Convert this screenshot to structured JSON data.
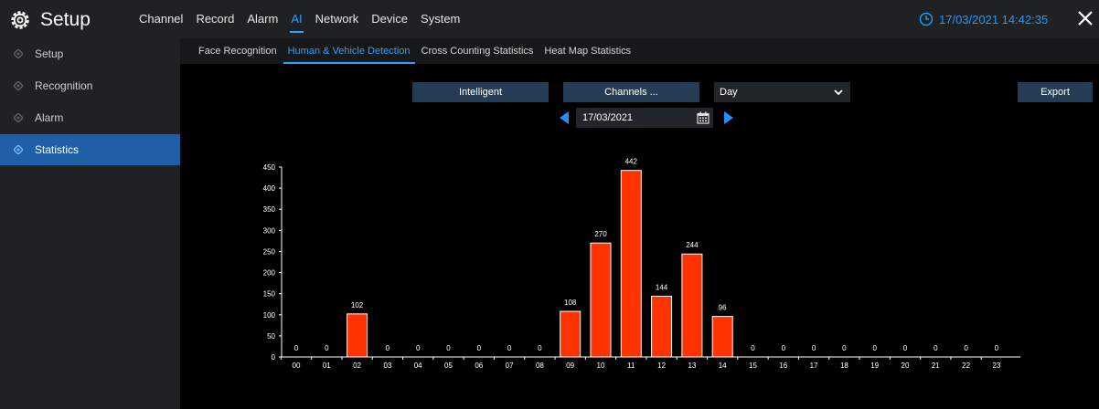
{
  "app": {
    "title": "Setup",
    "datetime": "17/03/2021 14:42:35"
  },
  "menu": [
    "Channel",
    "Record",
    "Alarm",
    "AI",
    "Network",
    "Device",
    "System"
  ],
  "menu_active": "AI",
  "sidebar": {
    "items": [
      {
        "label": "Setup"
      },
      {
        "label": "Recognition"
      },
      {
        "label": "Alarm"
      },
      {
        "label": "Statistics"
      }
    ],
    "active": "Statistics"
  },
  "tabs": [
    "Face Recognition",
    "Human & Vehicle Detection",
    "Cross Counting Statistics",
    "Heat Map Statistics"
  ],
  "active_tab": "Human & Vehicle Detection",
  "controls": {
    "intelligent_label": "Intelligent",
    "channels_label": "Channels ...",
    "period_value": "Day",
    "export_label": "Export",
    "date_value": "17/03/2021"
  },
  "colors": {
    "accent": "#29a3ff",
    "bar": "#ff3300",
    "button": "#263c55",
    "sidebar_active": "#1e5fa8"
  },
  "chart_data": {
    "type": "bar",
    "categories": [
      "00",
      "01",
      "02",
      "03",
      "04",
      "05",
      "06",
      "07",
      "08",
      "09",
      "10",
      "11",
      "12",
      "13",
      "14",
      "15",
      "16",
      "17",
      "18",
      "19",
      "20",
      "21",
      "22",
      "23"
    ],
    "values": [
      0,
      0,
      102,
      0,
      0,
      0,
      0,
      0,
      0,
      108,
      270,
      442,
      144,
      244,
      96,
      0,
      0,
      0,
      0,
      0,
      0,
      0,
      0,
      0
    ],
    "yticks": [
      0,
      50,
      100,
      150,
      200,
      250,
      300,
      350,
      400,
      450
    ],
    "ylim": [
      0,
      450
    ],
    "title": "",
    "xlabel": "",
    "ylabel": "",
    "grid": false
  }
}
